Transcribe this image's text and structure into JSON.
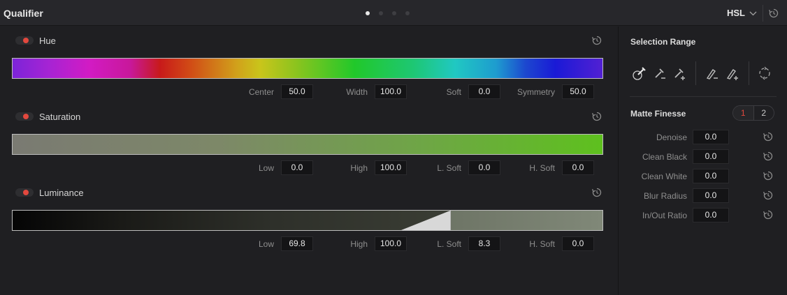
{
  "header": {
    "title": "Qualifier",
    "mode": "HSL",
    "page_count": 4,
    "active_page": 1
  },
  "hue": {
    "label": "Hue",
    "enabled": true,
    "params": [
      {
        "label": "Center",
        "value": "50.0"
      },
      {
        "label": "Width",
        "value": "100.0"
      },
      {
        "label": "Soft",
        "value": "0.0"
      },
      {
        "label": "Symmetry",
        "value": "50.0"
      }
    ]
  },
  "saturation": {
    "label": "Saturation",
    "enabled": true,
    "params": [
      {
        "label": "Low",
        "value": "0.0"
      },
      {
        "label": "High",
        "value": "100.0"
      },
      {
        "label": "L. Soft",
        "value": "0.0"
      },
      {
        "label": "H. Soft",
        "value": "0.0"
      }
    ]
  },
  "luminance": {
    "label": "Luminance",
    "enabled": true,
    "params": [
      {
        "label": "Low",
        "value": "69.8"
      },
      {
        "label": "High",
        "value": "100.0"
      },
      {
        "label": "L. Soft",
        "value": "8.3"
      },
      {
        "label": "H. Soft",
        "value": "0.0"
      }
    ]
  },
  "selection_range": {
    "title": "Selection Range",
    "tools": [
      "picker-icon",
      "picker-subtract-icon",
      "picker-add-icon",
      "softness-subtract-icon",
      "softness-add-icon",
      "invert-icon"
    ]
  },
  "matte_finesse": {
    "title": "Matte Finesse",
    "tabs": [
      "1",
      "2"
    ],
    "active_tab": "1",
    "params": [
      {
        "label": "Denoise",
        "value": "0.0"
      },
      {
        "label": "Clean Black",
        "value": "0.0"
      },
      {
        "label": "Clean White",
        "value": "0.0"
      },
      {
        "label": "Blur Radius",
        "value": "0.0"
      },
      {
        "label": "In/Out Ratio",
        "value": "0.0"
      }
    ]
  },
  "colors": {
    "background": "#1f1f22",
    "header": "#27272b",
    "toggle_on": "#e2483e",
    "field_bg": "#141416"
  }
}
